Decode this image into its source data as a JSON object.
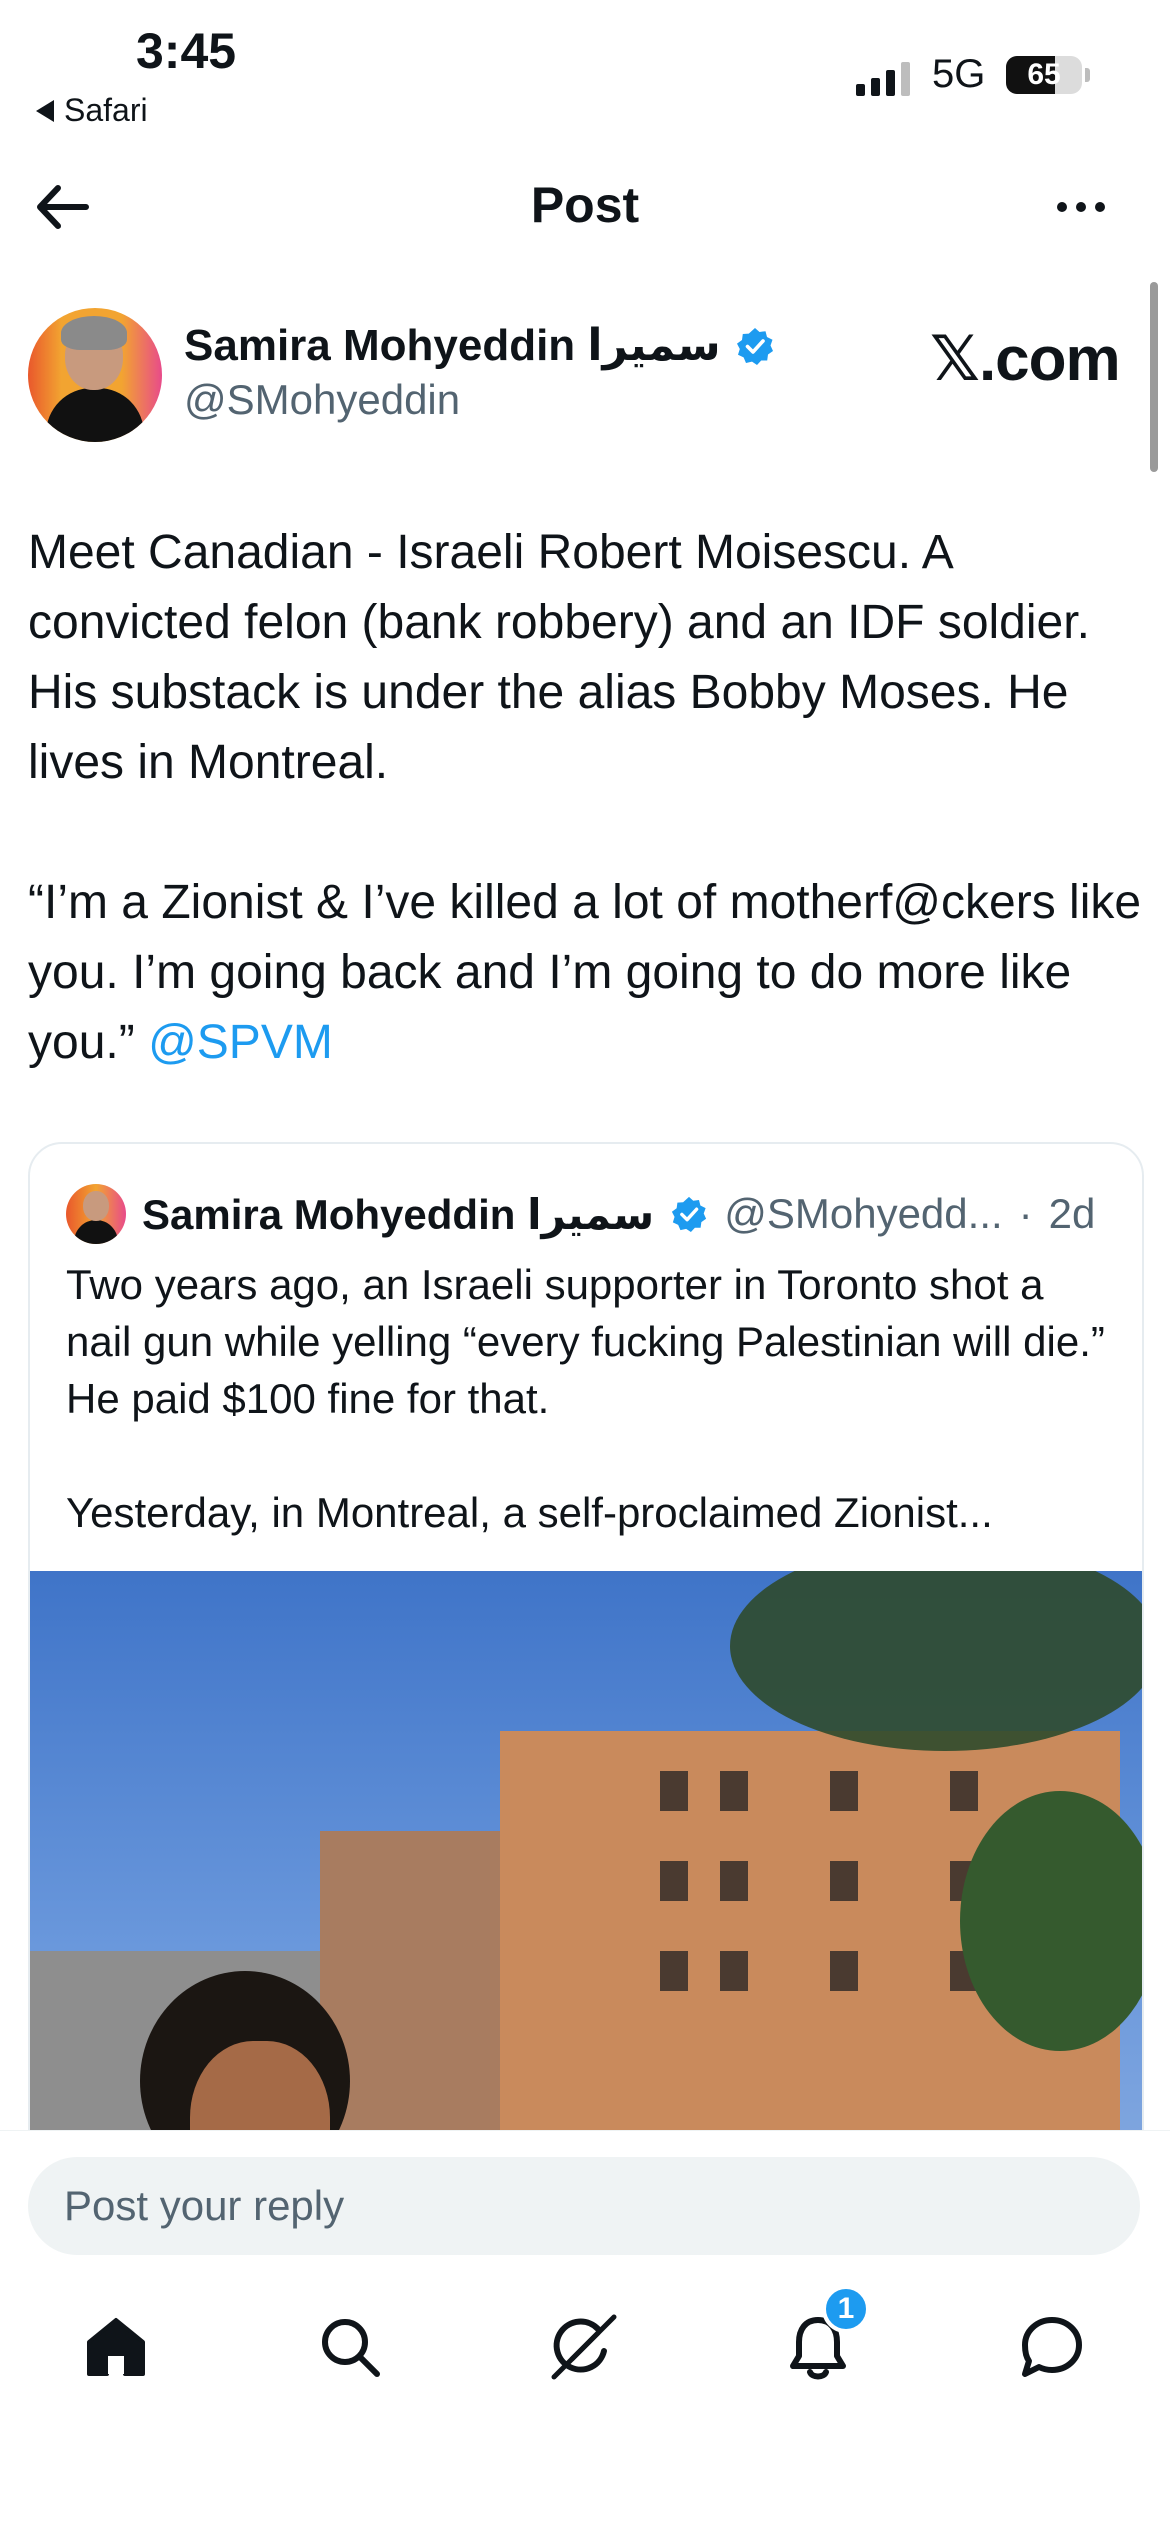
{
  "status_bar": {
    "time": "3:45",
    "back_app": "Safari",
    "network": "5G",
    "battery": "65",
    "battery_level": 0.65
  },
  "header": {
    "title": "Post",
    "back_icon": "arrow-left-icon",
    "more_icon": "more-horizontal-icon"
  },
  "post": {
    "author_name": "Samira Mohyeddin سميرا",
    "author_handle": "@SMohyeddin",
    "verified": true,
    "watermark": "𝕏.com",
    "text_p1": "Meet Canadian - Israeli Robert Moisescu. A convicted felon (bank robbery) and an IDF soldier. His substack is under the alias Bobby Moses. He lives in Montreal.",
    "text_p2": "“I’m a Zionist & I’ve killed a lot of motherf@ckers like you. I’m going back and I’m going to do more like you.”",
    "mention": "@SPVM"
  },
  "quoted_post": {
    "author_name": "Samira Mohyeddin سميرا",
    "author_handle": "@SMohyedd...",
    "separator": "·",
    "time": "2d",
    "text_p1": "Two years ago, an Israeli supporter in Toronto shot a nail gun while yelling “every fucking Palestinian will die.” He paid $100 fine for that.",
    "text_p2": "Yesterday, in Montreal, a self-proclaimed Zionist..."
  },
  "reply": {
    "placeholder": "Post your reply"
  },
  "bottom_nav": {
    "items": [
      "home-icon",
      "search-icon",
      "grok-icon",
      "notifications-icon",
      "messages-icon"
    ],
    "notifications_badge": "1"
  },
  "colors": {
    "accent": "#1d9bf0",
    "text": "#0f1419",
    "secondary_text": "#536471",
    "border": "#e6ecf0"
  }
}
